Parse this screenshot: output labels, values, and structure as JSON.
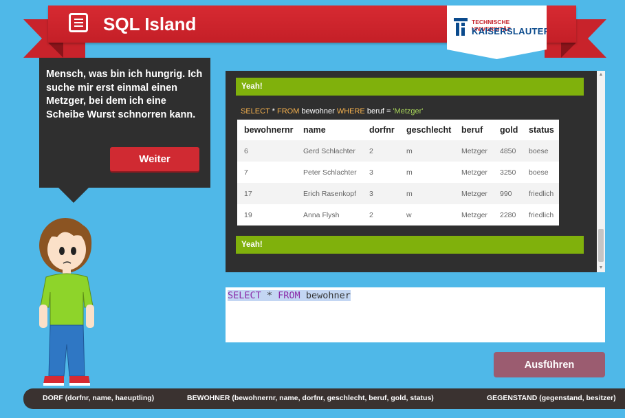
{
  "header": {
    "app_title": "SQL Island",
    "app_icon": "document-list-icon",
    "university_line1": "TECHNISCHE UNIVERSITÄT",
    "university_line2": "KAISERSLAUTERN",
    "colors": {
      "ribbon": "#c41f27",
      "university_blue": "#0a4a8c"
    }
  },
  "speech": {
    "text": "Mensch, was bin ich hungrig. Ich suche mir erst einmal einen Metzger, bei dem ich eine Scheibe Wurst schnorren kann.",
    "button_label": "Weiter"
  },
  "result": {
    "banner_top": "Yeah!",
    "banner_bottom": "Yeah!",
    "query": {
      "kw1": "SELECT",
      "part1": " * ",
      "kw2": "FROM",
      "part2": " bewohner ",
      "kw3": "WHERE",
      "part3": " beruf = ",
      "str": "'Metzger'"
    },
    "columns": [
      "bewohnernr",
      "name",
      "dorfnr",
      "geschlecht",
      "beruf",
      "gold",
      "status"
    ],
    "rows": [
      [
        "6",
        "Gerd Schlachter",
        "2",
        "m",
        "Metzger",
        "4850",
        "boese"
      ],
      [
        "7",
        "Peter Schlachter",
        "3",
        "m",
        "Metzger",
        "3250",
        "boese"
      ],
      [
        "17",
        "Erich Rasenkopf",
        "3",
        "m",
        "Metzger",
        "990",
        "friedlich"
      ],
      [
        "19",
        "Anna Flysh",
        "2",
        "w",
        "Metzger",
        "2280",
        "friedlich"
      ]
    ],
    "colors": {
      "success": "#80b10c",
      "keyword": "#f7b24e",
      "string": "#a8d45a"
    }
  },
  "editor": {
    "kw1": "SELECT",
    "part1": " * ",
    "kw2": "FROM",
    "part2": " bewohner"
  },
  "run_button": {
    "label": "Ausführen"
  },
  "schema": [
    "DORF (dorfnr, name, haeuptling)",
    "BEWOHNER (bewohnernr, name, dorfnr, geschlecht, beruf, gold, status)",
    "GEGENSTAND (gegenstand, besitzer)"
  ]
}
